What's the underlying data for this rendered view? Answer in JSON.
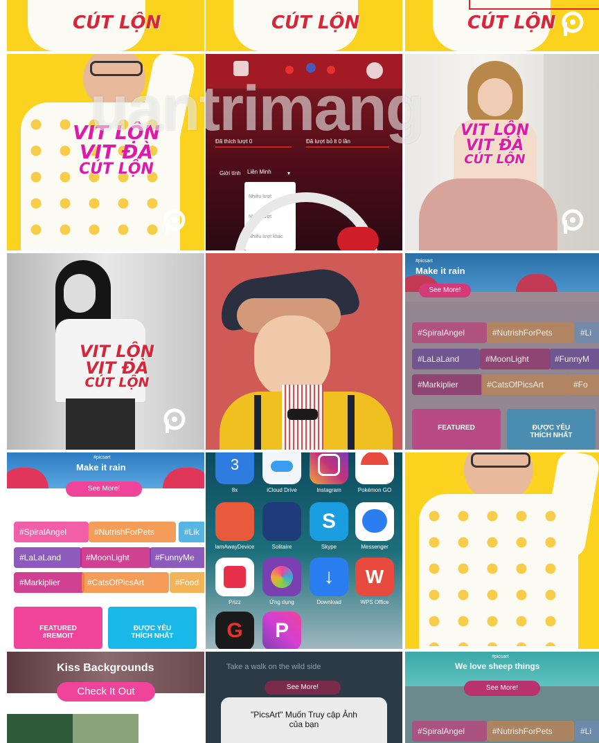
{
  "watermark": "uantrimang",
  "shirt_text": [
    "VIT LỘN",
    "VIT ĐÀ",
    "CÚT LỘN"
  ],
  "top_row_text": "CÚT LỘN",
  "dark_app": {
    "field1": "Đã thích lượt 0",
    "field2": "Đã lượt bỏ lt 0 lần",
    "label": "Giới tính",
    "select": "Liên Minh",
    "options": [
      "Nhiều lượt",
      "Nhiều lượt",
      "Nhiều lượt khác"
    ]
  },
  "promo1": {
    "banner_small": "#picsart",
    "banner_title": "Make it rain",
    "see_more": "See More!",
    "tags_row1": [
      "#SpiralAngel",
      "#NutrishForPets",
      "#Li"
    ],
    "tags_row2": [
      "#LaLaLand",
      "#MoonLight",
      "#FunnyM"
    ],
    "tags_row3": [
      "#Markiplier",
      "#CatsOfPicsArt",
      "#Fo"
    ],
    "btn_featured": [
      "FEATURED",
      "#REMOIT"
    ],
    "btn_liked": [
      "ĐƯỢC YÊU",
      "THÍCH NHẤT"
    ]
  },
  "promo2": {
    "banner_small": "#picsart",
    "banner_title": "Make it rain",
    "see_more": "See More!",
    "tags_row1": [
      "#SpiralAngel",
      "#NutrishForPets",
      "#Lik"
    ],
    "tags_row2": [
      "#LaLaLand",
      "#MoonLight",
      "#FunnyMe"
    ],
    "tags_row3": [
      "#Markiplier",
      "#CatsOfPicsArt",
      "#Food"
    ],
    "btn_featured": [
      "FEATURED",
      "#REMOIT"
    ],
    "btn_liked": [
      "ĐƯỢC YÊU",
      "THÍCH NHẤT"
    ]
  },
  "apps": [
    {
      "label": "8x",
      "color": "#2f7ce0"
    },
    {
      "label": "iCloud Drive",
      "color": "#f2f6fb"
    },
    {
      "label": "Instagram",
      "color": "#c2337c"
    },
    {
      "label": "Pokémon GO",
      "color": "#e84a3d"
    },
    {
      "label": "lamAwayDevice",
      "color": "#e85a3b"
    },
    {
      "label": "Solitaire",
      "color": "#1e3c7a"
    },
    {
      "label": "Skype",
      "color": "#1a9ee0"
    },
    {
      "label": "Messenger",
      "color": "#ffffff"
    },
    {
      "label": "Prizz",
      "color": "#ffffff"
    },
    {
      "label": "Ứng dụng",
      "color": "#7a3fb0"
    },
    {
      "label": "Download",
      "color": "#2a7ef0"
    },
    {
      "label": "WPS Office",
      "color": "#e84a3d"
    },
    {
      "label": "Garena",
      "color": "#1a1a1a"
    },
    {
      "label": "PicsArt",
      "color": "#d13fd4"
    }
  ],
  "bottom1": {
    "title": "Kiss Backgrounds",
    "button": "Check It Out"
  },
  "bottom2": {
    "banner": "Take a walk on the wild side",
    "see_more": "See More!",
    "dialog": [
      "\"PicsArt\" Muốn Truy cập Ảnh",
      "của bạn"
    ]
  },
  "bottom3": {
    "banner_small": "#picsart",
    "banner_title": "We love sheep things",
    "see_more": "See More!",
    "tags": [
      "#SpiralAngel",
      "#NutrishForPets",
      "#Li"
    ]
  },
  "colors": {
    "yellow": "#fbd31f",
    "magenta": "#e01aa8",
    "pink_tag": "#f0449a",
    "orange_tag": "#f28d3c",
    "purple_tag": "#7a3fb0"
  }
}
